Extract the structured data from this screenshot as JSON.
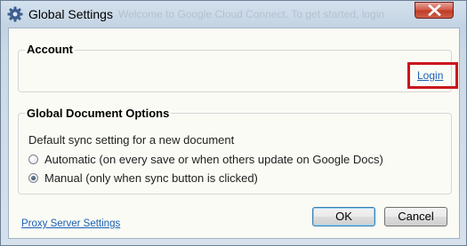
{
  "window": {
    "title": "Global Settings",
    "ghost_text": "Welcome to Google Cloud Connect. To get started, login"
  },
  "account": {
    "title": "Account",
    "login_link": "Login"
  },
  "document_options": {
    "title": "Global Document Options",
    "description": "Default sync setting for a new document",
    "options": [
      {
        "label": "Automatic (on every save or when others update on Google Docs)",
        "selected": false
      },
      {
        "label": "Manual (only when sync button is clicked)",
        "selected": true
      }
    ]
  },
  "footer": {
    "proxy_link": "Proxy Server Settings",
    "ok_label": "OK",
    "cancel_label": "Cancel"
  },
  "colors": {
    "highlight": "#c8161d",
    "link": "#1a5fb4",
    "close_button": "#c13b27"
  },
  "icons": {
    "title": "gear-icon",
    "close": "close-icon"
  }
}
